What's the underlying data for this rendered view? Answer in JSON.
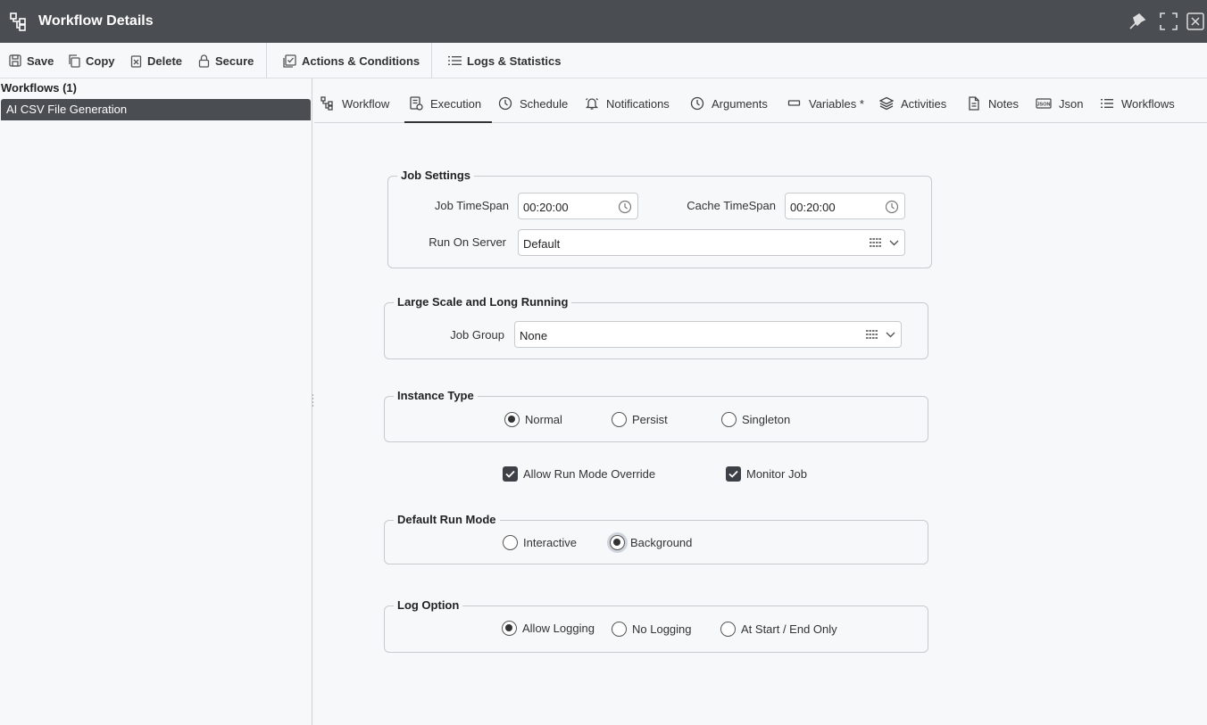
{
  "window": {
    "title": "Workflow Details"
  },
  "toolbar": {
    "save": "Save",
    "copy": "Copy",
    "delete": "Delete",
    "secure": "Secure",
    "actions": "Actions & Conditions",
    "logs": "Logs & Statistics"
  },
  "sidebar": {
    "title": "Workflows (1)",
    "items": [
      {
        "label": "AI CSV File Generation",
        "selected": true
      }
    ]
  },
  "tabs": [
    {
      "label": "Workflow",
      "icon": "workflow-icon"
    },
    {
      "label": "Execution",
      "icon": "execution-icon",
      "active": true
    },
    {
      "label": "Schedule",
      "icon": "clock-icon"
    },
    {
      "label": "Notifications",
      "icon": "bell-icon"
    },
    {
      "label": "Arguments",
      "icon": "clock-icon"
    },
    {
      "label": "Variables *",
      "icon": "rectangle-icon"
    },
    {
      "label": "Activities",
      "icon": "layers-icon"
    },
    {
      "label": "Notes",
      "icon": "document-icon"
    },
    {
      "label": "Json",
      "icon": "json-icon"
    },
    {
      "label": "Workflows",
      "icon": "list-icon"
    }
  ],
  "job_settings": {
    "title": "Job Settings",
    "job_timespan_label": "Job TimeSpan",
    "job_timespan_value": "00:20:00",
    "cache_timespan_label": "Cache TimeSpan",
    "cache_timespan_value": "00:20:00",
    "run_on_server_label": "Run On Server",
    "run_on_server_value": "Default"
  },
  "large_scale": {
    "title": "Large Scale and Long Running",
    "job_group_label": "Job Group",
    "job_group_value": "None"
  },
  "instance_type": {
    "title": "Instance Type",
    "options": [
      "Normal",
      "Persist",
      "Singleton"
    ],
    "selected": "Normal"
  },
  "checks": {
    "allow_override_label": "Allow Run Mode Override",
    "allow_override_checked": true,
    "monitor_job_label": "Monitor Job",
    "monitor_job_checked": true
  },
  "default_run_mode": {
    "title": "Default Run Mode",
    "options": [
      "Interactive",
      "Background"
    ],
    "selected": "Background"
  },
  "log_option": {
    "title": "Log Option",
    "options": [
      "Allow Logging",
      "No Logging",
      "At Start / End Only"
    ],
    "selected": "Allow Logging"
  }
}
